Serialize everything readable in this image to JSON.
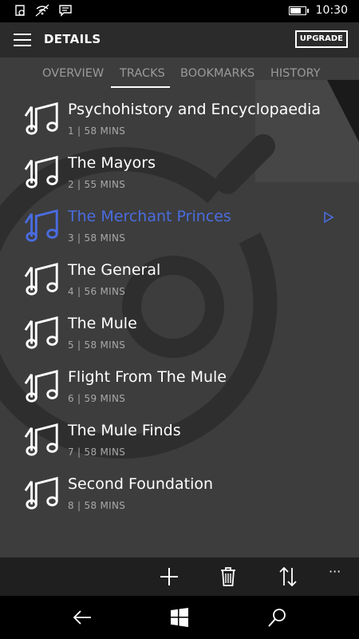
{
  "status_bar": {
    "time": "10:30",
    "battery_level": 0.8
  },
  "header": {
    "title": "DETAILS",
    "upgrade_label": "UPGRADE"
  },
  "tabs": [
    {
      "label": "OVERVIEW"
    },
    {
      "label": "TRACKS"
    },
    {
      "label": "BOOKMARKS"
    },
    {
      "label": "HISTORY"
    }
  ],
  "active_tab": "TRACKS",
  "tracks": [
    {
      "title": "Psychohistory and Encyclopaedia",
      "meta": "1 | 58 MINS"
    },
    {
      "title": "The Mayors",
      "meta": "2 | 55 MINS"
    },
    {
      "title": "The Merchant Princes",
      "meta": "3 | 58 MINS"
    },
    {
      "title": "The General",
      "meta": "4 | 56 MINS"
    },
    {
      "title": "The Mule",
      "meta": "5 | 58 MINS"
    },
    {
      "title": "Flight From The Mule",
      "meta": "6 | 59 MINS"
    },
    {
      "title": "The Mule Finds",
      "meta": "7 | 58 MINS"
    },
    {
      "title": "Second Foundation",
      "meta": "8 | 58 MINS"
    }
  ],
  "selected_track": "The Merchant Princes",
  "app_bar": {
    "more_label": "···"
  },
  "colors": {
    "accent": "#4a6ce0",
    "background": "#3d3d3d",
    "header": "#2b2b2b",
    "app_bar": "#1f1f1f"
  },
  "icons": {
    "track": "music-note-icon",
    "play": "play-icon",
    "add": "plus-icon",
    "delete": "trash-icon",
    "sort": "sort-icon",
    "back": "back-arrow-icon",
    "home": "windows-icon",
    "search": "search-icon"
  }
}
